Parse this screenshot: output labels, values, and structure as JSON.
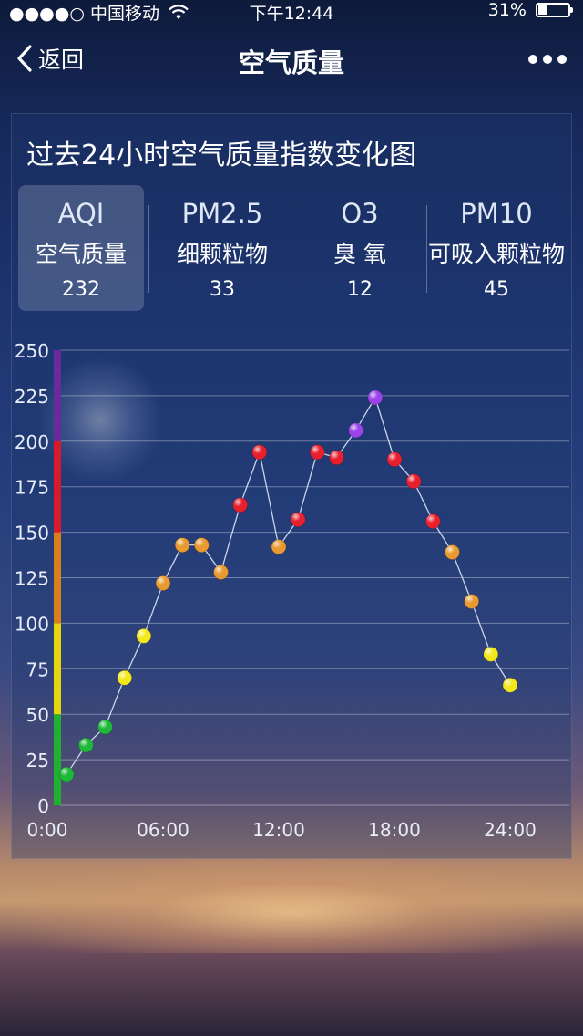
{
  "status_bar": {
    "signal": "●●●●○",
    "carrier": "中国移动",
    "time": "下午12:44",
    "battery": "31%",
    "battery_level": 0.31
  },
  "nav": {
    "back_label": "返回",
    "title": "空气质量",
    "more_icon": "more-dots-icon"
  },
  "card": {
    "title": "过去24小时空气质量指数变化图",
    "tabs": [
      {
        "code": "AQI",
        "name": "空气质量",
        "value": "232",
        "selected": true
      },
      {
        "code": "PM2.5",
        "name": "细颗粒物",
        "value": "33",
        "selected": false
      },
      {
        "code": "O3",
        "name": "臭 氧",
        "value": "12",
        "selected": false
      },
      {
        "code": "PM10",
        "name": "可吸入颗粒物",
        "value": "45",
        "selected": false
      }
    ]
  },
  "chart_data": {
    "type": "line",
    "title": "",
    "xlabel": "",
    "ylabel": "",
    "x_tick_labels": [
      "0:00",
      "06:00",
      "12:00",
      "18:00",
      "24:00"
    ],
    "y_ticks": [
      0,
      25,
      50,
      75,
      100,
      125,
      150,
      175,
      200,
      225,
      250
    ],
    "ylim": [
      0,
      250
    ],
    "xlim": [
      0,
      24
    ],
    "grid": true,
    "level_bands": [
      {
        "from": 0,
        "to": 50,
        "color": "#22b030"
      },
      {
        "from": 50,
        "to": 100,
        "color": "#e6d60e"
      },
      {
        "from": 100,
        "to": 150,
        "color": "#d9801a"
      },
      {
        "from": 150,
        "to": 200,
        "color": "#d81a2a"
      },
      {
        "from": 200,
        "to": 250,
        "color": "#6a2a9a"
      }
    ],
    "series": [
      {
        "x": [
          1,
          2,
          3,
          4,
          5,
          6,
          7,
          8,
          9,
          10,
          11,
          12,
          13,
          14,
          15,
          16,
          17,
          18,
          19,
          20,
          21,
          22,
          23,
          24
        ],
        "y": [
          17,
          33,
          43,
          70,
          93,
          122,
          143,
          143,
          128,
          165,
          194,
          142,
          157,
          194,
          191,
          206,
          224,
          190,
          178,
          156,
          139,
          112,
          83,
          66
        ]
      }
    ]
  }
}
